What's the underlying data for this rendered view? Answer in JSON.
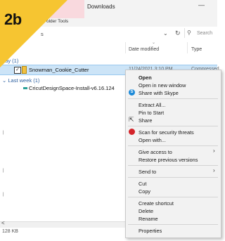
{
  "badge": {
    "text": "2b",
    "color": "#f6c531"
  },
  "ribbon": {
    "tab_downloads": "Downloads",
    "tab_folder_tools": "Folder Tools",
    "minimize": "—"
  },
  "address": {
    "partial_text": "s",
    "chevron": "⌄",
    "refresh": "↻",
    "search_placeholder": "Search"
  },
  "columns": {
    "date": "Date modified",
    "type": "Type"
  },
  "groups": {
    "today": "day (1)",
    "last_week": "Last week (1)"
  },
  "files": {
    "snowman": {
      "name": "Snowman_Cookie_Cutter",
      "date": "11/24/2021 3:10 PM",
      "type": "Compressed"
    },
    "cricut": {
      "name": "CricutDesignSpace-Install-v6.16.124"
    }
  },
  "status": {
    "size": "128 KB"
  },
  "context_menu": {
    "open": "Open",
    "open_new_window": "Open in new window",
    "share_skype": "Share with Skype",
    "extract_all": "Extract All...",
    "pin_start": "Pin to Start",
    "share": "Share",
    "scan_threats": "Scan for security threats",
    "open_with": "Open with...",
    "give_access": "Give access to",
    "restore_versions": "Restore previous versions",
    "send_to": "Send to",
    "cut": "Cut",
    "copy": "Copy",
    "create_shortcut": "Create shortcut",
    "delete": "Delete",
    "rename": "Rename",
    "properties": "Properties"
  }
}
